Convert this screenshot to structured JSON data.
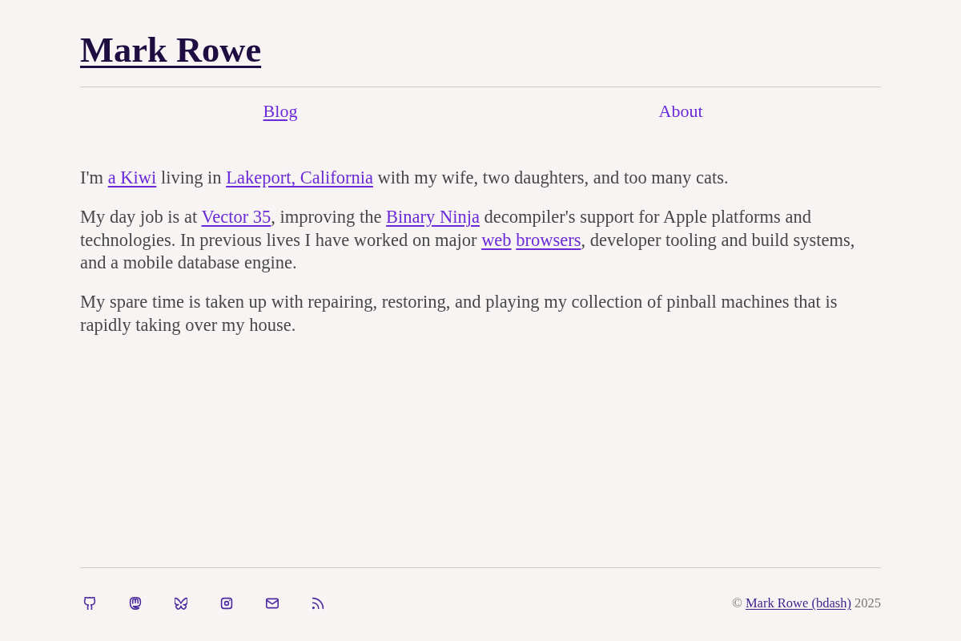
{
  "header": {
    "title": "Mark Rowe"
  },
  "nav": [
    {
      "label": "Blog",
      "selected": false
    },
    {
      "label": "About",
      "selected": true
    }
  ],
  "paragraphs": [
    {
      "segments": [
        {
          "kind": "text",
          "text": "I'm "
        },
        {
          "kind": "link",
          "text": "a Kiwi"
        },
        {
          "kind": "text",
          "text": " living in "
        },
        {
          "kind": "link",
          "text": "Lakeport, California"
        },
        {
          "kind": "text",
          "text": " with my wife, two daughters, and too many cats."
        }
      ]
    },
    {
      "segments": [
        {
          "kind": "text",
          "text": "My day job is at "
        },
        {
          "kind": "link",
          "text": "Vector 35"
        },
        {
          "kind": "text",
          "text": ", improving the "
        },
        {
          "kind": "link",
          "text": "Binary Ninja"
        },
        {
          "kind": "text",
          "text": " decompiler's support for Apple platforms and technologies. In previous lives I have worked on major "
        },
        {
          "kind": "link",
          "text": "web"
        },
        {
          "kind": "space"
        },
        {
          "kind": "link",
          "text": "browsers"
        },
        {
          "kind": "text",
          "text": ", developer tooling and build systems, and a mobile database engine."
        }
      ]
    },
    {
      "segments": [
        {
          "kind": "text",
          "text": "My spare time is taken up with repairing, restoring, and playing my collection of pinball machines that is rapidly taking over my house."
        }
      ]
    }
  ],
  "footer": {
    "links": [
      {
        "kind": "github"
      },
      {
        "kind": "mastodon"
      },
      {
        "kind": "bluesky"
      },
      {
        "kind": "instagram"
      },
      {
        "kind": "mail"
      },
      {
        "kind": "rss"
      }
    ],
    "copyright": [
      {
        "kind": "text",
        "text": "© "
      },
      {
        "kind": "link",
        "text": "Mark Rowe (bdash)"
      },
      {
        "kind": "text",
        "text": " 2025"
      }
    ]
  }
}
